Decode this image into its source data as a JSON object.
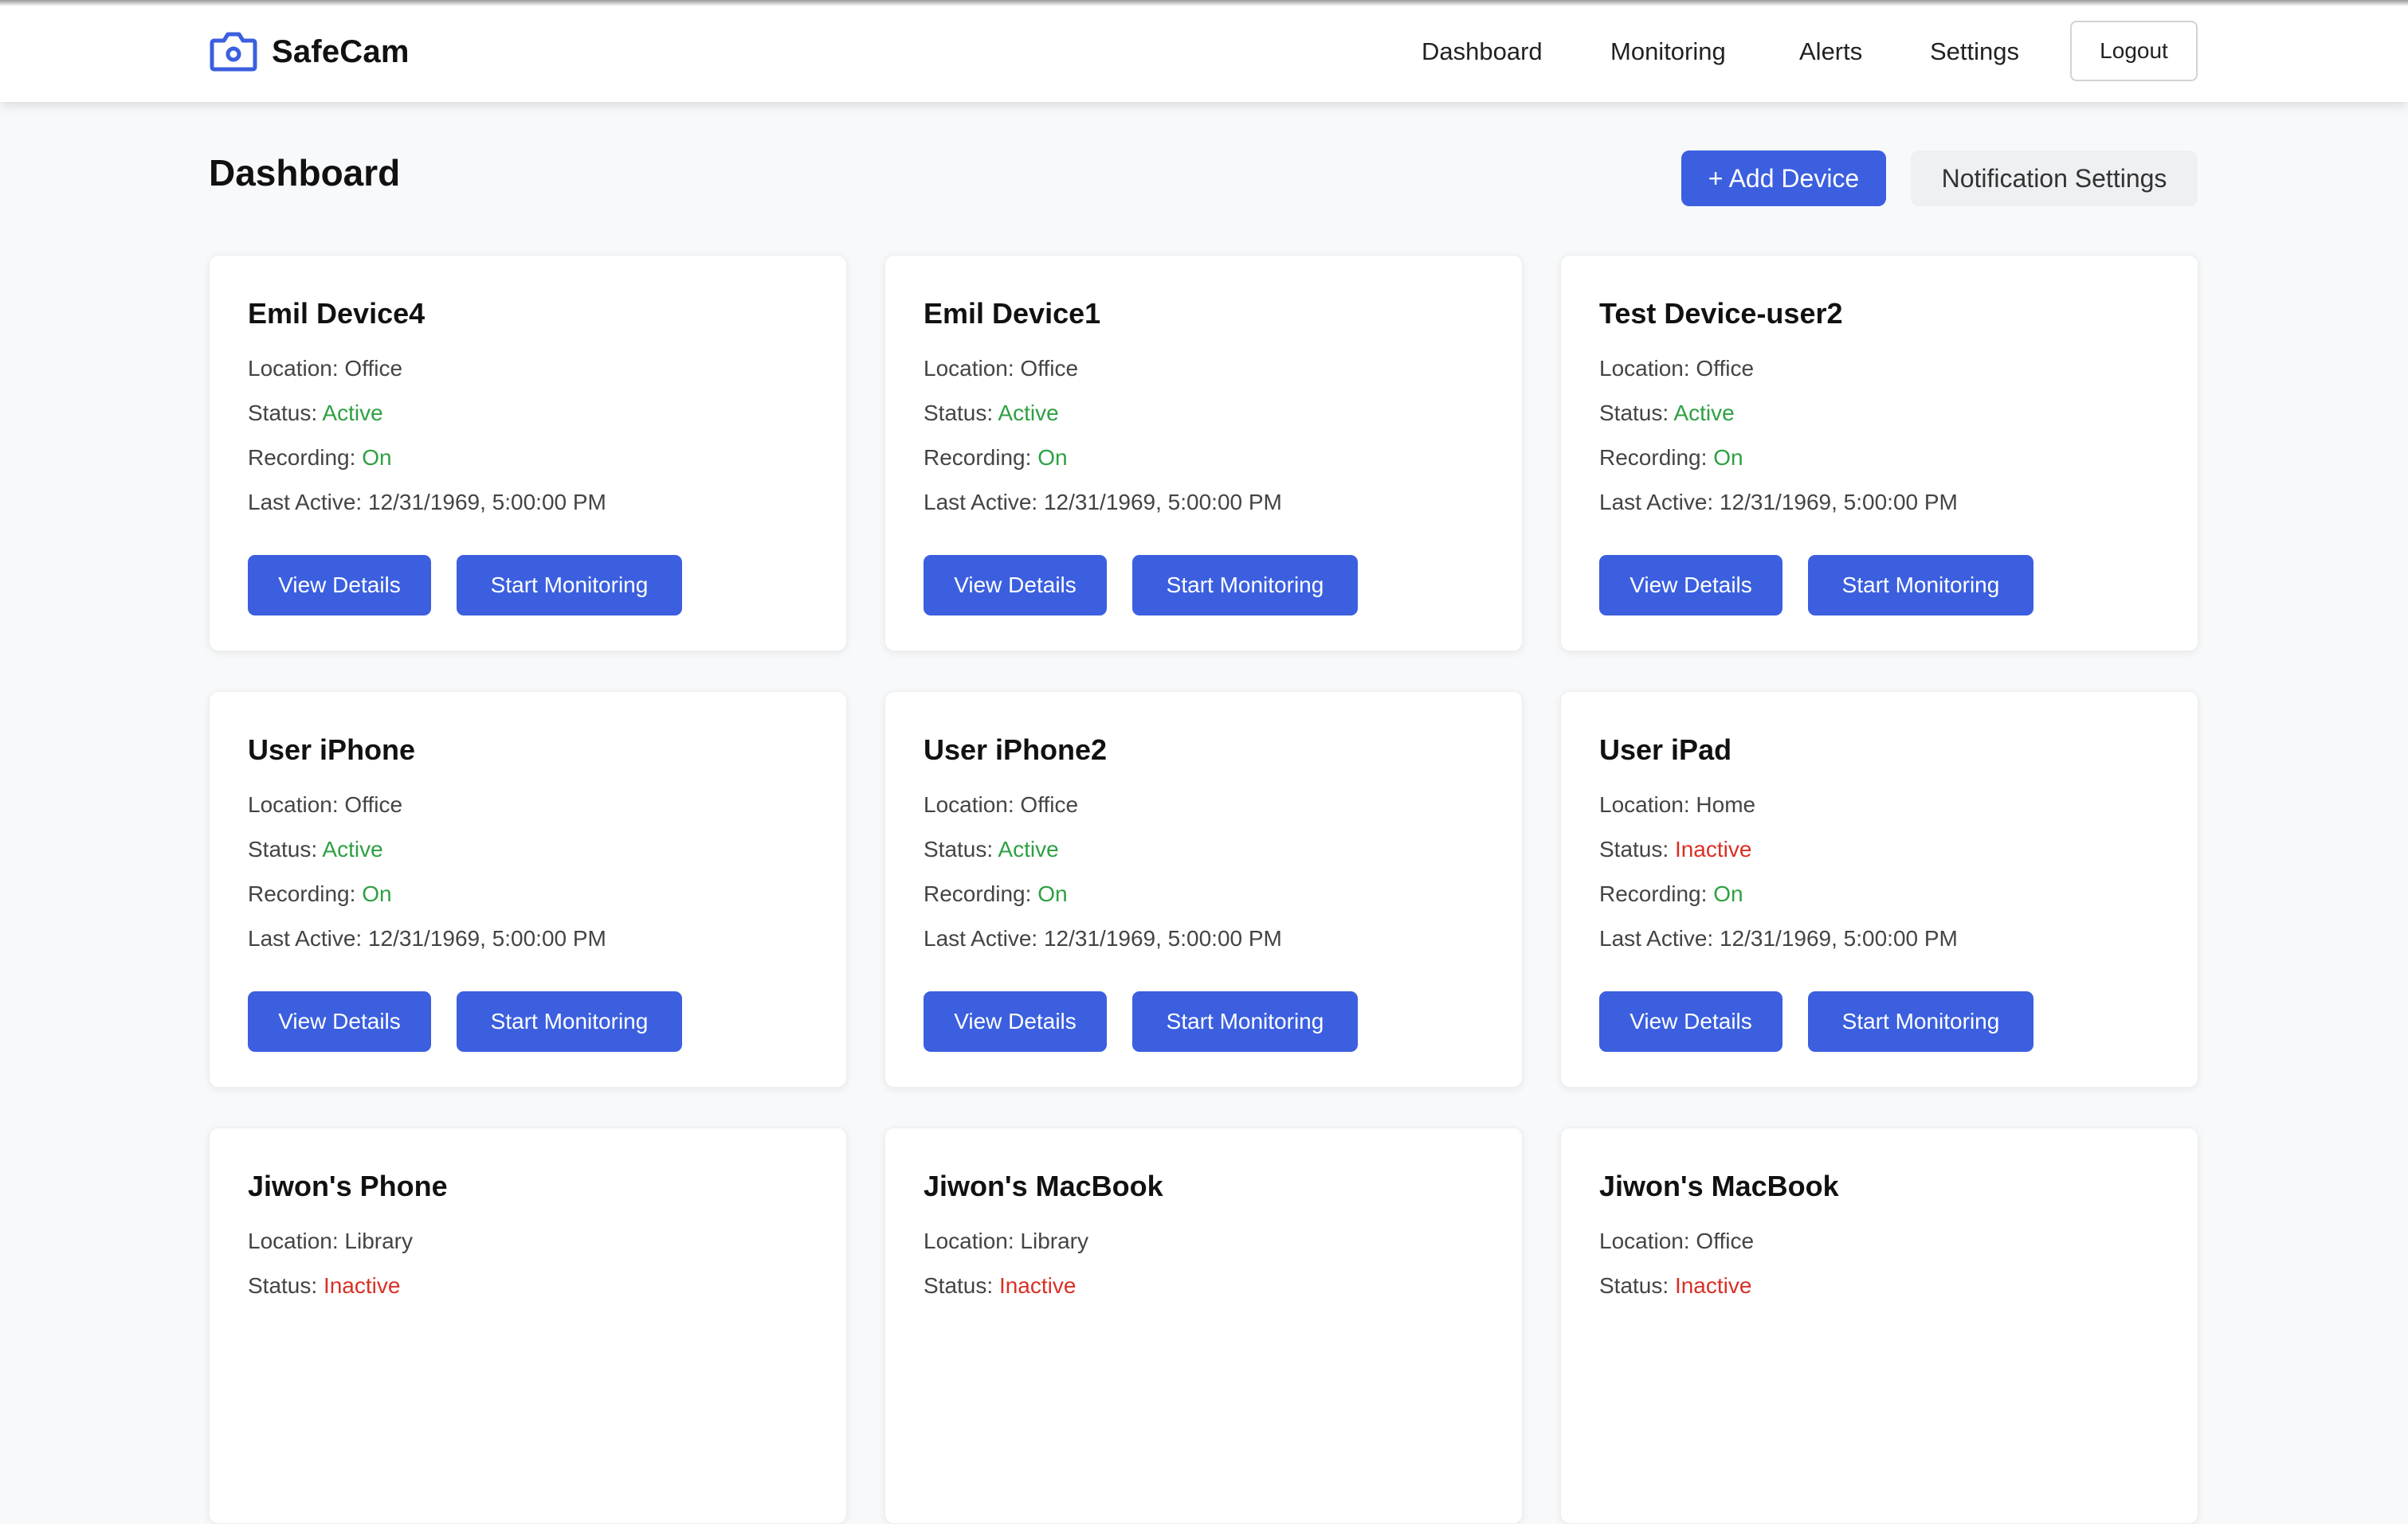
{
  "brand": {
    "name": "SafeCam",
    "icon": "camera-icon",
    "accent": "#3b5fdf"
  },
  "nav": {
    "links": [
      "Dashboard",
      "Monitoring",
      "Alerts",
      "Settings"
    ],
    "logout": "Logout"
  },
  "page": {
    "title": "Dashboard",
    "add_device": "+ Add Device",
    "notification_settings": "Notification Settings"
  },
  "labels": {
    "location": "Location: ",
    "status": "Status: ",
    "recording": "Recording: ",
    "last_active": "Last Active: ",
    "view_details": "View Details",
    "start_monitoring": "Start Monitoring"
  },
  "colors": {
    "active": "#2ea043",
    "inactive": "#d93025",
    "primary_button": "#3b5fdf"
  },
  "devices": [
    {
      "name": "Emil Device4",
      "location": "Office",
      "status": "Active",
      "recording": "On",
      "last_active": "12/31/1969, 5:00:00 PM"
    },
    {
      "name": "Emil Device1",
      "location": "Office",
      "status": "Active",
      "recording": "On",
      "last_active": "12/31/1969, 5:00:00 PM"
    },
    {
      "name": "Test Device-user2",
      "location": "Office",
      "status": "Active",
      "recording": "On",
      "last_active": "12/31/1969, 5:00:00 PM"
    },
    {
      "name": "User iPhone",
      "location": "Office",
      "status": "Active",
      "recording": "On",
      "last_active": "12/31/1969, 5:00:00 PM"
    },
    {
      "name": "User iPhone2",
      "location": "Office",
      "status": "Active",
      "recording": "On",
      "last_active": "12/31/1969, 5:00:00 PM"
    },
    {
      "name": "User iPad",
      "location": "Home",
      "status": "Inactive",
      "recording": "On",
      "last_active": "12/31/1969, 5:00:00 PM"
    },
    {
      "name": "Jiwon's Phone",
      "location": "Library",
      "status": "Inactive"
    },
    {
      "name": "Jiwon's MacBook",
      "location": "Library",
      "status": "Inactive"
    },
    {
      "name": "Jiwon's MacBook",
      "location": "Office",
      "status": "Inactive"
    }
  ]
}
